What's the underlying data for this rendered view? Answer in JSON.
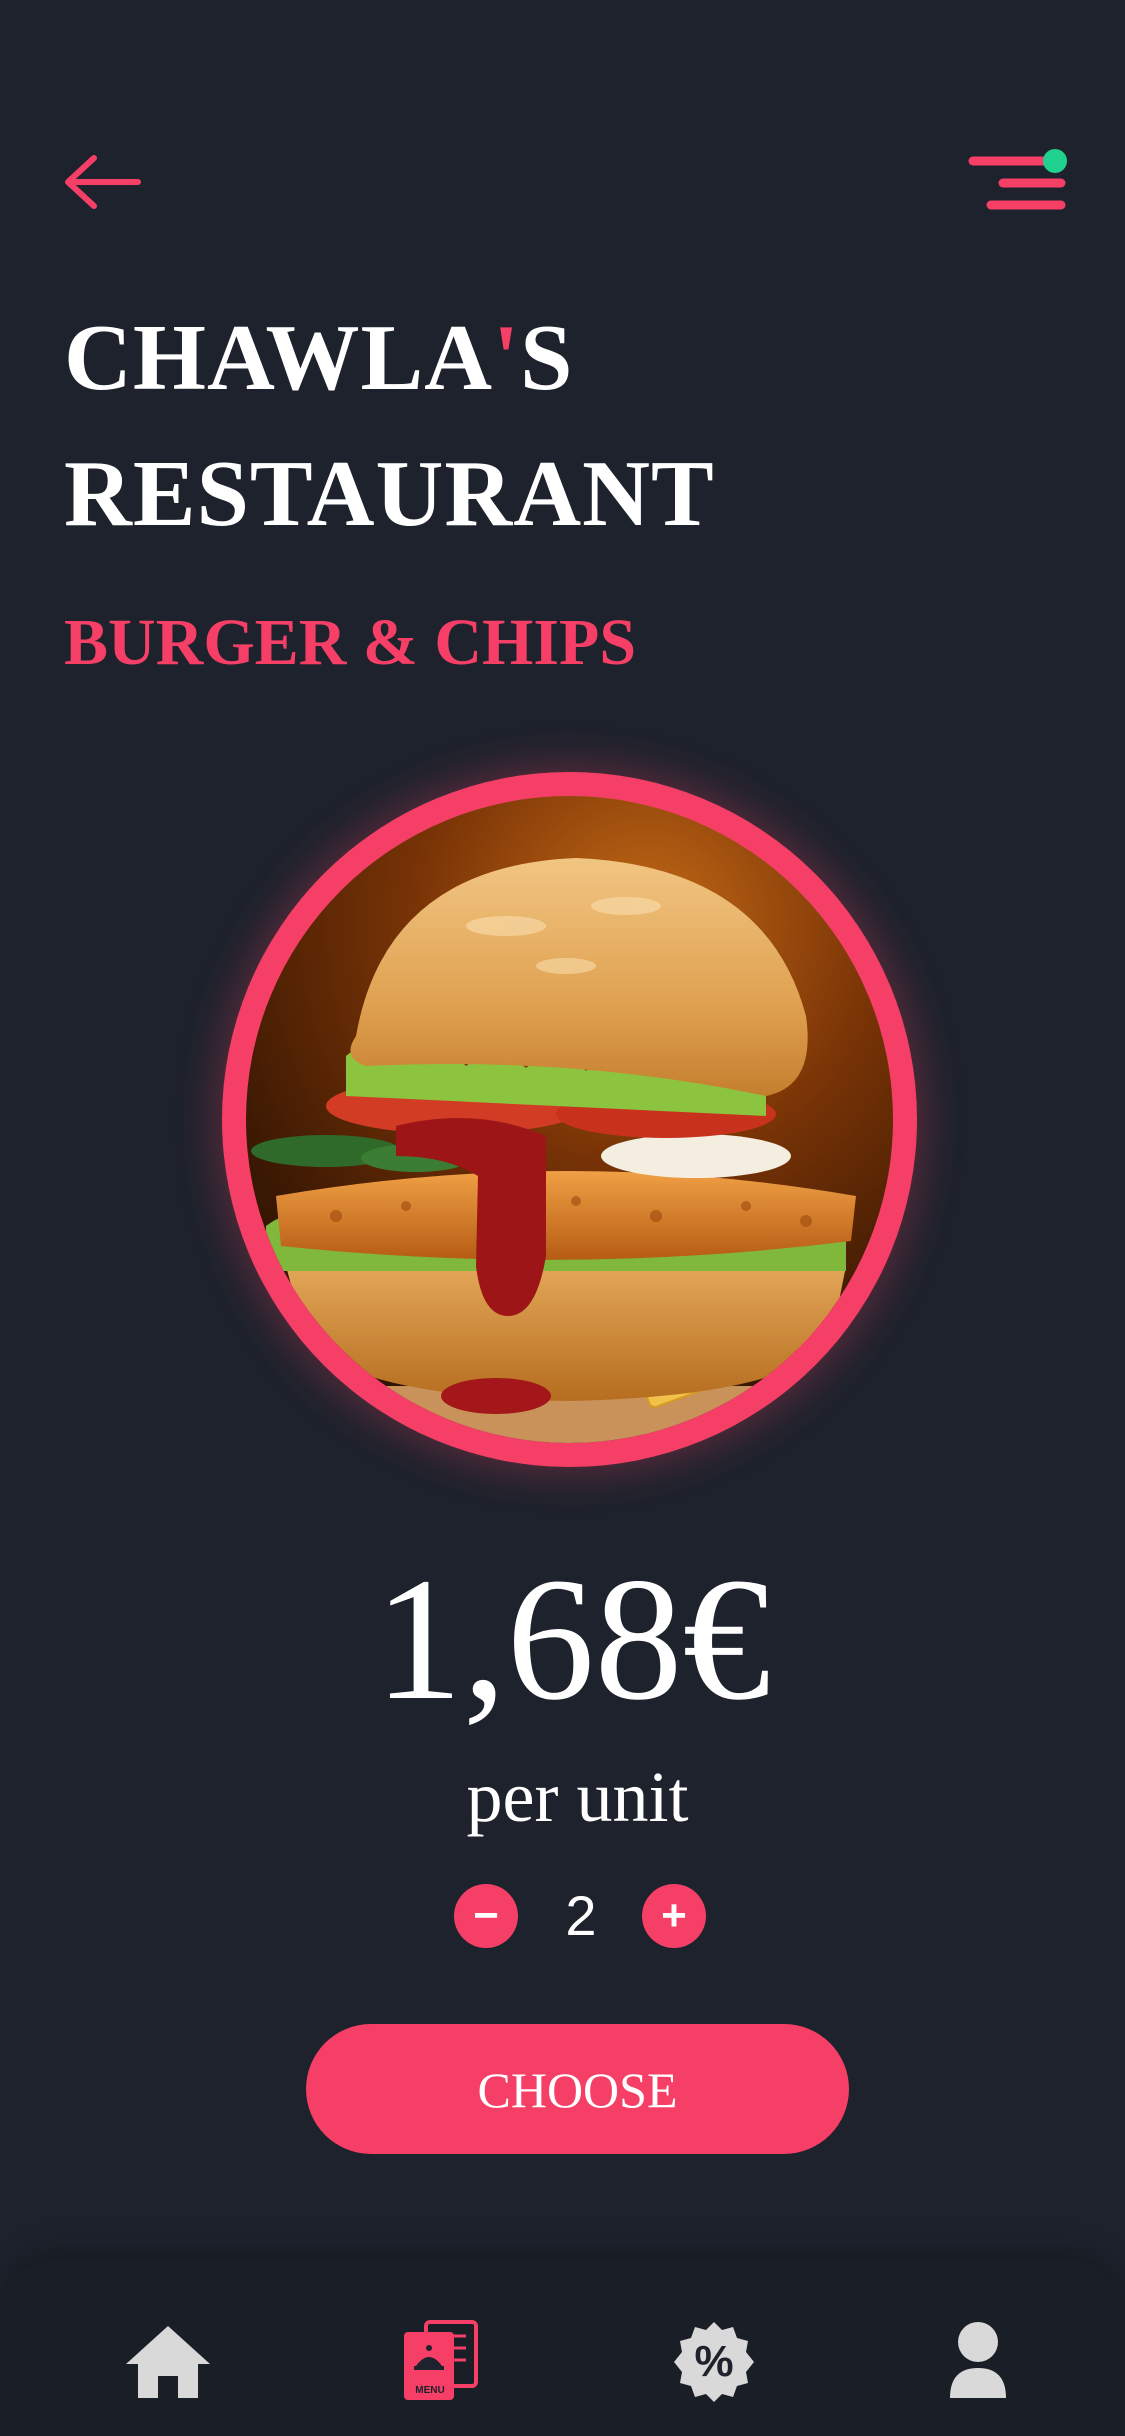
{
  "header": {
    "back_icon": "arrow-left-icon",
    "menu_icon": "hamburger-menu-icon",
    "notification_dot_color": "#1fd08e"
  },
  "restaurant": {
    "name_part1": "CHAWLA",
    "name_apostrophe": "'",
    "name_part2": "S",
    "name_line2": "RESTAURANT"
  },
  "product": {
    "name": "BURGER & CHIPS",
    "image_icon": "burger-and-chips-photo",
    "price": "1,68€",
    "price_unit": "per unit"
  },
  "quantity": {
    "value": "2",
    "decrement_label": "−",
    "increment_label": "+"
  },
  "actions": {
    "choose_label": "CHOOSE"
  },
  "bottom_nav": {
    "items": [
      {
        "icon": "home-icon",
        "active": false
      },
      {
        "icon": "menu-book-icon",
        "label": "MENU",
        "active": true
      },
      {
        "icon": "discount-badge-icon",
        "label": "%",
        "active": false
      },
      {
        "icon": "user-profile-icon",
        "active": false
      }
    ]
  },
  "colors": {
    "background": "#1d222c",
    "accent": "#f63f66",
    "text": "#ffffff",
    "inactive_icon": "#d9d9d9",
    "online": "#1fd08e"
  }
}
